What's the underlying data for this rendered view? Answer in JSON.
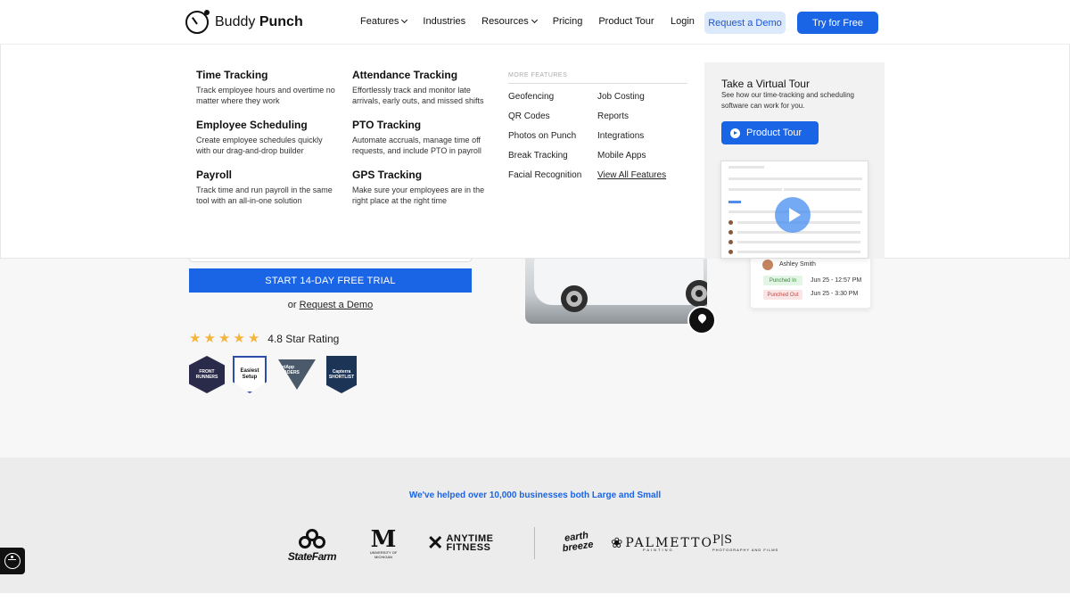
{
  "brand": {
    "name_regular": "Buddy",
    "name_bold": "Punch"
  },
  "nav": {
    "items": [
      {
        "label": "Features",
        "dropdown": true
      },
      {
        "label": "Industries",
        "dropdown": false
      },
      {
        "label": "Resources",
        "dropdown": true
      },
      {
        "label": "Pricing",
        "dropdown": false
      },
      {
        "label": "Product Tour",
        "dropdown": false
      }
    ],
    "login": "Login",
    "request_demo": "Request a Demo",
    "try_free": "Try for Free"
  },
  "menu": {
    "features": [
      {
        "title": "Time Tracking",
        "desc": "Track employee hours and overtime no matter where they work"
      },
      {
        "title": "Employee Scheduling",
        "desc": "Create employee schedules quickly with our drag-and-drop builder"
      },
      {
        "title": "Payroll",
        "desc": "Track time and run payroll in the same tool with an all-in-one solution"
      },
      {
        "title": "Attendance Tracking",
        "desc": "Effortlessly track and monitor late arrivals, early outs, and missed shifts"
      },
      {
        "title": "PTO Tracking",
        "desc": "Automate accruals, manage time off requests, and include PTO in payroll"
      },
      {
        "title": "GPS Tracking",
        "desc": "Make sure your employees are in the right place at the right time"
      }
    ],
    "more_label": "MORE FEATURES",
    "more_left": [
      "Geofencing",
      "QR Codes",
      "Photos on Punch",
      "Break Tracking",
      "Facial Recognition"
    ],
    "more_right": [
      "Job Costing",
      "Reports",
      "Integrations",
      "Mobile Apps",
      "View All Features"
    ],
    "tour": {
      "title": "Take a Virtual Tour",
      "desc": "See how our time-tracking and scheduling software can work for you.",
      "button": "Product Tour"
    }
  },
  "hero": {
    "trial_button": "START 14-DAY FREE TRIAL",
    "or_text": "or",
    "demo_link": "Request a Demo",
    "rating_text": "4.8 Star Rating",
    "rating_value": 4.8,
    "badges": [
      "FRONT RUNNERS",
      "Easiest Setup",
      "GetApp LEADERS",
      "Capterra SHORTLIST"
    ]
  },
  "punch_card": {
    "name": "Ashley Smith",
    "punched_in": "Punched In",
    "punched_out": "Punched Out",
    "in_time": "Jun 25 - 12:57 PM",
    "out_time": "Jun 25 - 3:30 PM"
  },
  "logos": {
    "title": "We've helped over 10,000 businesses both Large and Small",
    "statefarm": "StateFarm",
    "michigan_m": "M",
    "michigan_sub": "UNIVERSITY OF MICHIGAN",
    "anytime_line1": "ANYTIME",
    "anytime_line2": "FITNESS",
    "earth_line1": "earth",
    "earth_line2": "breeze",
    "palmetto": "PALMETTO",
    "palmetto_sub": "PAINTING",
    "ps": "P|S",
    "ps_sub": "PHOTOGRAPHY AND FILMS"
  },
  "colors": {
    "accent": "#1a64e6",
    "accent_light": "#dbe9fb",
    "star": "#f4b53f"
  }
}
